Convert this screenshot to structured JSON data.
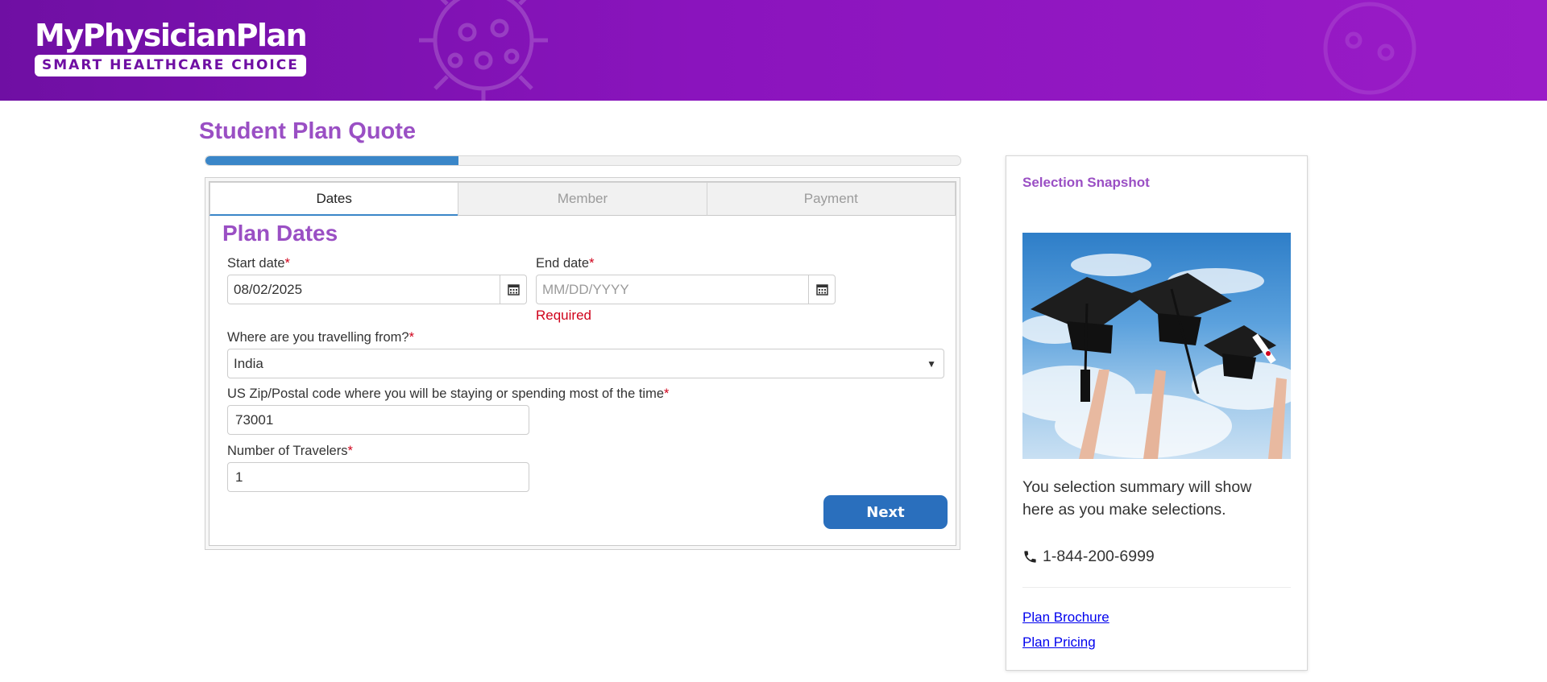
{
  "header": {
    "logo_title": "MyPhysicianPlan",
    "logo_subtitle": "SMART HEALTHCARE CHOICE"
  },
  "page": {
    "title": "Student Plan Quote",
    "progress_fraction": 0.335
  },
  "tabs": [
    {
      "label": "Dates",
      "active": true
    },
    {
      "label": "Member",
      "active": false
    },
    {
      "label": "Payment",
      "active": false
    }
  ],
  "form": {
    "section_title": "Plan Dates",
    "start_date": {
      "label": "Start date",
      "required_mark": "*",
      "value": "08/02/2025"
    },
    "end_date": {
      "label": "End date",
      "required_mark": "*",
      "placeholder": "MM/DD/YYYY",
      "error": "Required"
    },
    "travelling_from": {
      "label": "Where are you travelling from?",
      "required_mark": "*",
      "value": "India"
    },
    "zip": {
      "label": "US Zip/Postal code where you will be staying or spending most of the time",
      "required_mark": "*",
      "value": "73001"
    },
    "travelers": {
      "label": "Number of Travelers",
      "required_mark": "*",
      "value": "1"
    },
    "next_label": "Next"
  },
  "sidebar": {
    "title": "Selection Snapshot",
    "summary_text": "You selection summary will show here as you make selections.",
    "phone": "1-844-200-6999",
    "links": [
      "Plan Brochure",
      "Plan Pricing"
    ]
  },
  "colors": {
    "brand_purple": "#8a14bd",
    "heading_purple": "#9a4fc4",
    "accent_blue": "#2a6fbd",
    "error_red": "#d0021b"
  }
}
